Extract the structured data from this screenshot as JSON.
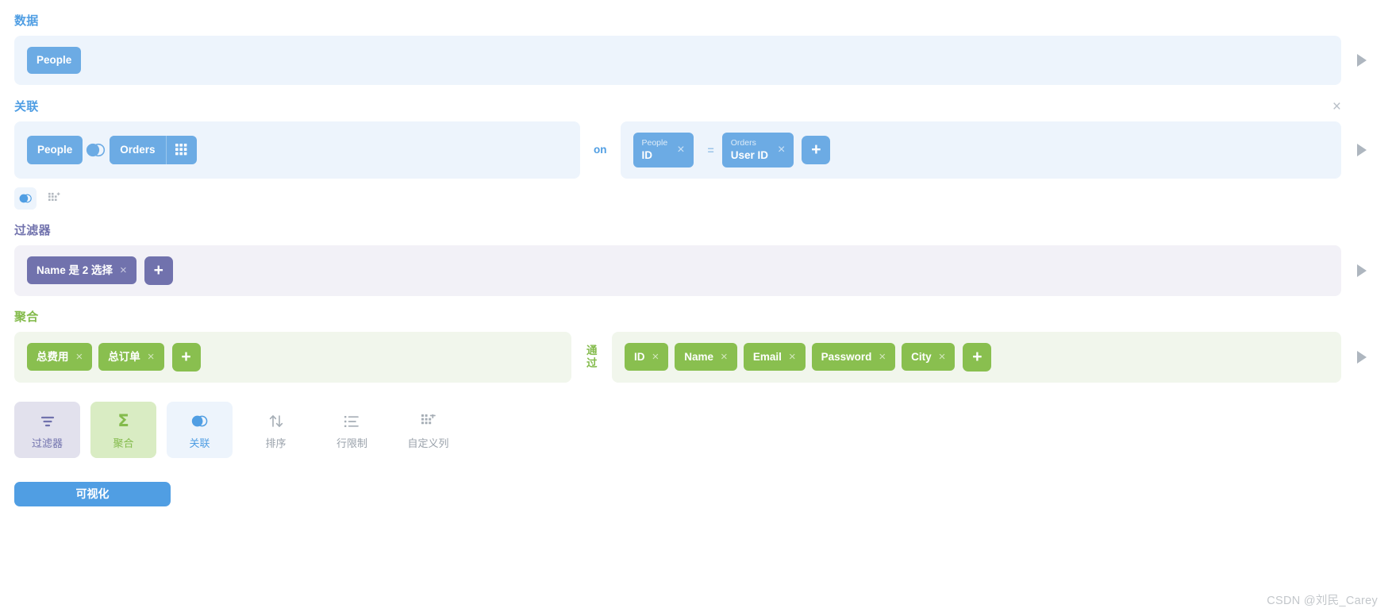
{
  "sections": {
    "data": {
      "title": "数据",
      "table": "People",
      "expand_icon": "play-triangle-icon"
    },
    "join": {
      "title": "关联",
      "left_table": "People",
      "right_table": "Orders",
      "venn_icon": "venn-join-icon",
      "columns_icon": "grid-columns-icon",
      "on_label": "on",
      "condition": {
        "left": {
          "table": "People",
          "field": "ID"
        },
        "operator": "=",
        "right": {
          "table": "Orders",
          "field": "User ID"
        }
      },
      "add_label": "+",
      "close_label": "×",
      "remove_label": "×",
      "sub_icons": [
        {
          "name": "join-type-icon",
          "active": true
        },
        {
          "name": "add-custom-column-icon",
          "active": false
        }
      ]
    },
    "filter": {
      "title": "过滤器",
      "chips": [
        "Name 是 2 选择"
      ],
      "add_label": "+",
      "remove_label": "×"
    },
    "summarize": {
      "title": "聚合",
      "metrics": [
        "总费用",
        "总订单"
      ],
      "by_label": "通过",
      "breakouts": [
        "ID",
        "Name",
        "Email",
        "Password",
        "City"
      ],
      "add_label": "+",
      "remove_label": "×"
    }
  },
  "toolbar": [
    {
      "label": "过滤器",
      "icon": "filter-icon",
      "state": "filter"
    },
    {
      "label": "聚合",
      "icon": "sigma-icon",
      "state": "agg"
    },
    {
      "label": "关联",
      "icon": "venn-join-icon",
      "state": "join"
    },
    {
      "label": "排序",
      "icon": "sort-arrows-icon",
      "state": "plain"
    },
    {
      "label": "行限制",
      "icon": "row-limit-list-icon",
      "state": "plain"
    },
    {
      "label": "自定义列",
      "icon": "custom-column-icon",
      "state": "plain"
    }
  ],
  "visualize": {
    "label": "可视化"
  },
  "watermark": "CSDN @刘民_Carey",
  "colors": {
    "blue": "#509ee3",
    "chip_blue": "#6cabe4",
    "panel_blue": "#edf4fc",
    "purple": "#7172ad",
    "panel_purple": "#f2f1f7",
    "green": "#84bb4c",
    "chip_green": "#89bf4f",
    "panel_green": "#f1f6ec",
    "gray": "#aeb6bf"
  }
}
